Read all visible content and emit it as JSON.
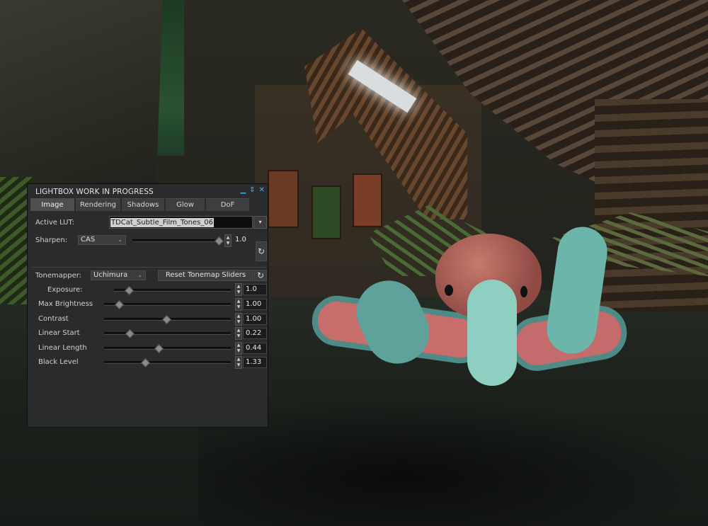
{
  "floater": {
    "title": "LIGHTBOX WORK IN PROGRESS",
    "controls": {
      "minimize_icon": "▁",
      "pin_icon": "⇕",
      "close_icon": "✕"
    },
    "tabs": [
      {
        "label": "Image",
        "active": true
      },
      {
        "label": "Rendering",
        "active": false
      },
      {
        "label": "Shadows",
        "active": false
      },
      {
        "label": "Glow",
        "active": false
      },
      {
        "label": "DoF",
        "active": false
      }
    ]
  },
  "image_tab": {
    "active_lut_label": "Active LUT:",
    "active_lut_value": "TDCat_Subtle_Film_Tones_06",
    "sharpen_label": "Sharpen:",
    "sharpen_mode": "CAS",
    "sharpen_value": "1.0",
    "tonemapper_label": "Tonemapper:",
    "tonemapper_value": "Uchimura",
    "reset_button": "Reset Tonemap Sliders",
    "sliders": [
      {
        "label": "Exposure:",
        "value": "1.0"
      },
      {
        "label": "Max Brightness",
        "value": "1.00"
      },
      {
        "label": "Contrast",
        "value": "1.00"
      },
      {
        "label": "Linear Start",
        "value": "0.22"
      },
      {
        "label": "Linear Length",
        "value": "0.44"
      },
      {
        "label": "Black Level",
        "value": "1.33"
      }
    ]
  },
  "icons": {
    "dropdown_arrow": "▾",
    "combo_arrow": "⌄",
    "spin_up": "▲",
    "spin_down": "▼",
    "reset": "↻"
  },
  "colors": {
    "panel_bg": "#2a2b2c",
    "accent_icons": "#4fb0e6"
  }
}
